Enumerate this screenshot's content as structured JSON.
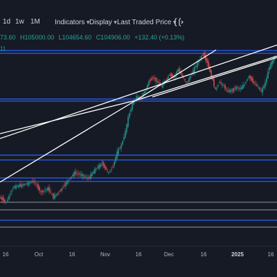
{
  "toolbar": {
    "tf_1d": "1d",
    "tf_1w": "1w",
    "tf_1m": "1M",
    "indicators": "Indicators",
    "display": "Display",
    "price_type": "Last Traded Price"
  },
  "ohlc": {
    "open": "73.60",
    "high": "H105000.00",
    "low": "L104654.60",
    "close": "C104906.00",
    "change": "+132.40 (+0.13%)"
  },
  "volume_fragment": "11",
  "colors": {
    "background": "#161a25",
    "up": "#26a69a",
    "down": "#ef5350",
    "h_line": "#2962ff",
    "trend_line": "#ffffff"
  },
  "xaxis": [
    {
      "label": "16",
      "bold": false
    },
    {
      "label": "Oct",
      "bold": false
    },
    {
      "label": "16",
      "bold": false
    },
    {
      "label": "Nov",
      "bold": false
    },
    {
      "label": "16",
      "bold": false
    },
    {
      "label": "Dec",
      "bold": false
    },
    {
      "label": "16",
      "bold": false
    },
    {
      "label": "2025",
      "bold": true
    },
    {
      "label": "16",
      "bold": false
    }
  ]
}
